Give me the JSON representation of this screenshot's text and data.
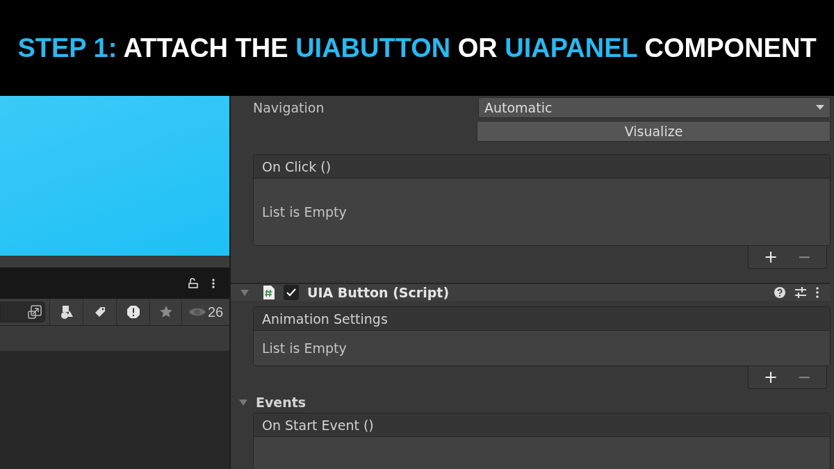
{
  "banner": {
    "title": [
      {
        "text": "STEP 1:",
        "highlight": true
      },
      {
        "text": "ATTACH THE",
        "highlight": false
      },
      {
        "text": "UIABUTTON",
        "highlight": true
      },
      {
        "text": "OR",
        "highlight": false
      },
      {
        "text": "UIAPANEL",
        "highlight": true
      },
      {
        "text": "COMPONENT",
        "highlight": false
      }
    ]
  },
  "hierarchy": {
    "visible_count": "26"
  },
  "inspector": {
    "navigation": {
      "label": "Navigation",
      "value": "Automatic",
      "button": "Visualize"
    },
    "on_click": {
      "title": "On Click ()",
      "empty_text": "List is Empty",
      "add": "+",
      "remove": "−"
    },
    "component": {
      "title": "UIA Button (Script)",
      "expanded": true,
      "enabled": true,
      "list": {
        "title": "Animation Settings",
        "empty_text": "List is Empty",
        "add": "+",
        "remove": "−"
      }
    },
    "events": {
      "label": "Events",
      "expanded": true,
      "first_event": "On Start Event ()"
    }
  }
}
